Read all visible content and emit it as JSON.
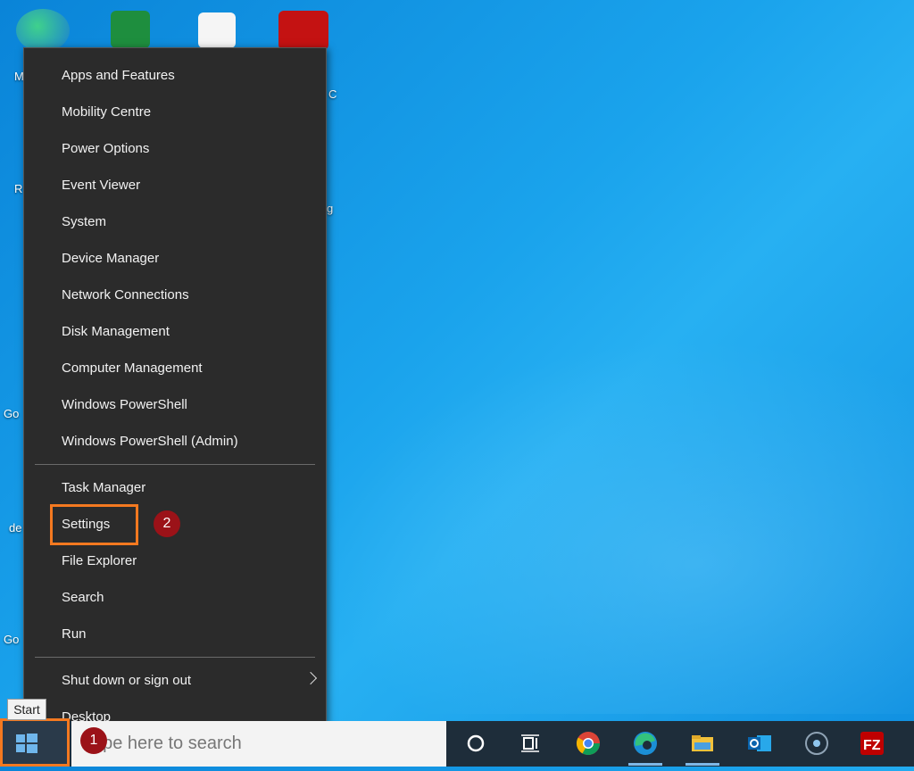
{
  "menu": {
    "items_group1": [
      "Apps and Features",
      "Mobility Centre",
      "Power Options",
      "Event Viewer",
      "System",
      "Device Manager",
      "Network Connections",
      "Disk Management",
      "Computer Management",
      "Windows PowerShell",
      "Windows PowerShell (Admin)"
    ],
    "items_group2": [
      "Task Manager",
      "Settings",
      "File Explorer",
      "Search",
      "Run"
    ],
    "items_group3": [
      "Shut down or sign out",
      "Desktop"
    ]
  },
  "desktop_fragments": [
    "M",
    "R",
    "Go",
    "de",
    "Go",
    "C",
    "g"
  ],
  "annotations": {
    "step1": "1",
    "step2": "2",
    "highlight_color": "#f47920",
    "badge_color": "#9b1218"
  },
  "taskbar": {
    "start_tooltip": "Start",
    "search_placeholder": "Type here to search",
    "icons": [
      "cortana-icon",
      "task-view-icon",
      "chrome-icon",
      "edge-icon",
      "file-explorer-icon",
      "outlook-icon",
      "app-circle-icon",
      "filezilla-icon"
    ]
  }
}
